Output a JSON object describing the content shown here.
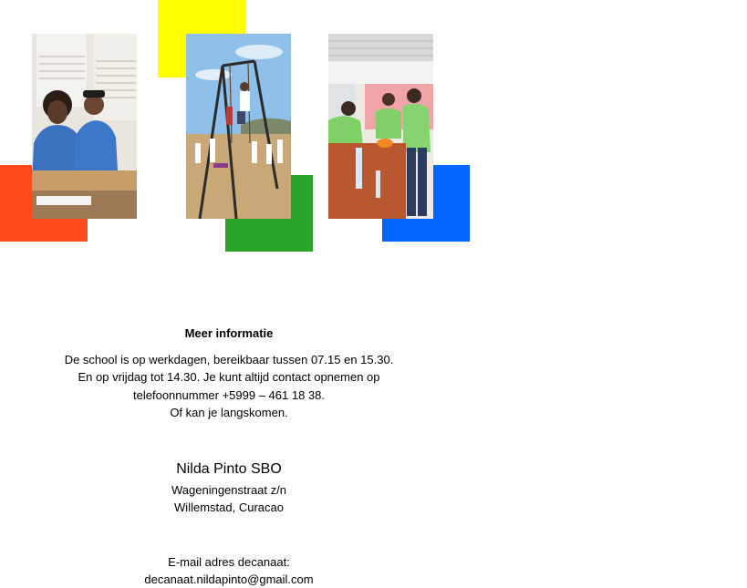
{
  "colors": {
    "red": "#ff4a1c",
    "yellow": "#ffff00",
    "green": "#2aa52a",
    "blue": "#0066ff"
  },
  "photos": [
    {
      "name": "students-classroom-photo"
    },
    {
      "name": "swing-playground-photo"
    },
    {
      "name": "students-activity-photo"
    }
  ],
  "info": {
    "heading": "Meer informatie",
    "lines": [
      "De school is op werkdagen, bereikbaar tussen 07.15 en 15.30.",
      "En op vrijdag tot 14.30.  Je kunt altijd contact opnemen op",
      "telefoonnummer +5999 – 461  18 38.",
      "Of kan je langskomen."
    ]
  },
  "address": {
    "school_name": "Nilda Pinto SBO",
    "street": "Wageningenstraat z/n",
    "city": "Willemstad, Curacao"
  },
  "email": {
    "label": "E-mail adres decanaat:",
    "value": "decanaat.nildapinto@gmail.com"
  }
}
